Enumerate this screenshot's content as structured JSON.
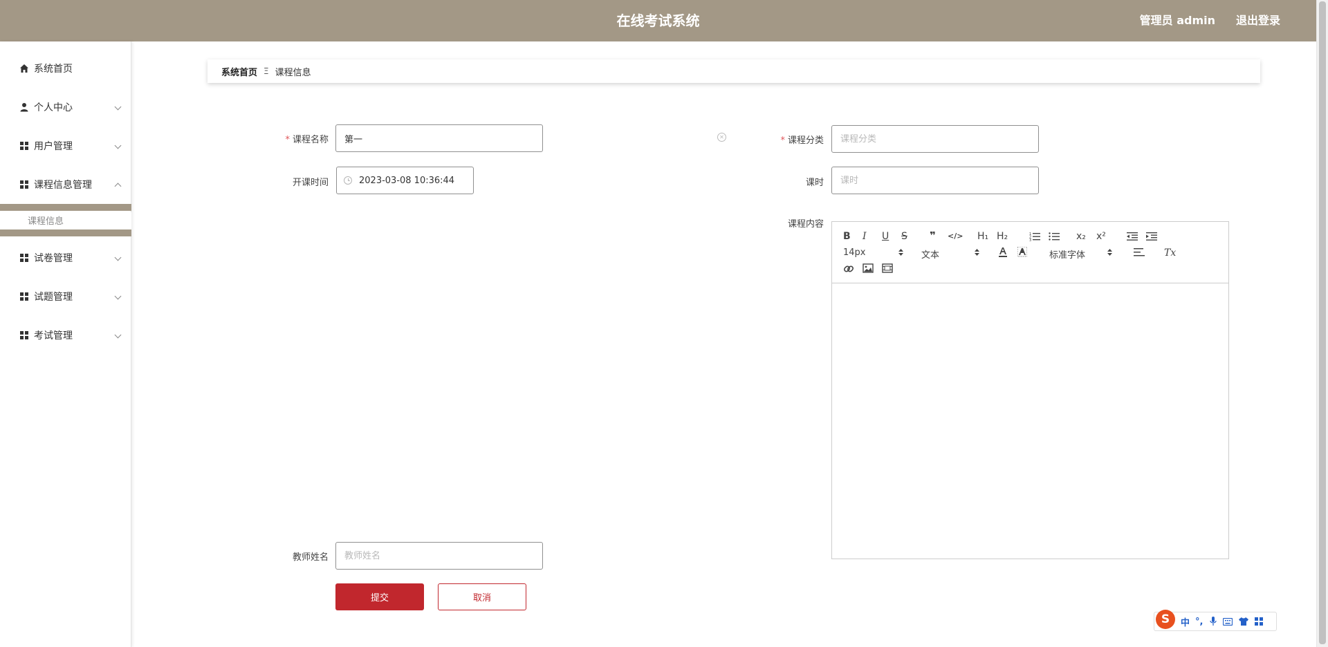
{
  "header": {
    "title": "在线考试系统",
    "user": "管理员 admin",
    "logout": "退出登录",
    "bg_color": "#a39886"
  },
  "sidebar": {
    "items": [
      {
        "label": "系统首页",
        "icon": "home-icon"
      },
      {
        "label": "个人中心",
        "icon": "person-icon"
      },
      {
        "label": "用户管理",
        "icon": "grid-icon"
      },
      {
        "label": "课程信息管理",
        "icon": "grid-icon"
      },
      {
        "label": "试卷管理",
        "icon": "grid-icon"
      },
      {
        "label": "试题管理",
        "icon": "grid-icon"
      },
      {
        "label": "考试管理",
        "icon": "grid-icon"
      }
    ],
    "active_sub": "课程信息"
  },
  "breadcrumb": {
    "home": "系统首页",
    "separator": "Ξ",
    "current": "课程信息"
  },
  "form": {
    "course_name_label": "课程名称",
    "course_name_value": "第一",
    "course_category_label": "课程分类",
    "course_category_placeholder": "课程分类",
    "start_time_label": "开课时间",
    "start_time_value": "2023-03-08 10:36:44",
    "hours_label": "课时",
    "hours_placeholder": "课时",
    "content_label": "课程内容",
    "teacher_label": "教师姓名",
    "teacher_placeholder": "教师姓名",
    "required_mark": "*"
  },
  "editor": {
    "font_size": "14px",
    "text_style": "文本",
    "font_family": "标准字体",
    "buttons": {
      "bold": "B",
      "italic": "I",
      "underline": "U",
      "strike": "S",
      "quote": "❞",
      "code": "</>",
      "h1": "H₁",
      "h2": "H₂",
      "subscript": "x₂",
      "superscript": "x²",
      "clear_format": "Tx"
    }
  },
  "buttons": {
    "submit": "提交",
    "cancel": "取消"
  },
  "ime": {
    "logo": "S",
    "mode": "中",
    "punct": "°,"
  },
  "colors": {
    "accent": "#c1272d",
    "brand": "#a39886"
  }
}
